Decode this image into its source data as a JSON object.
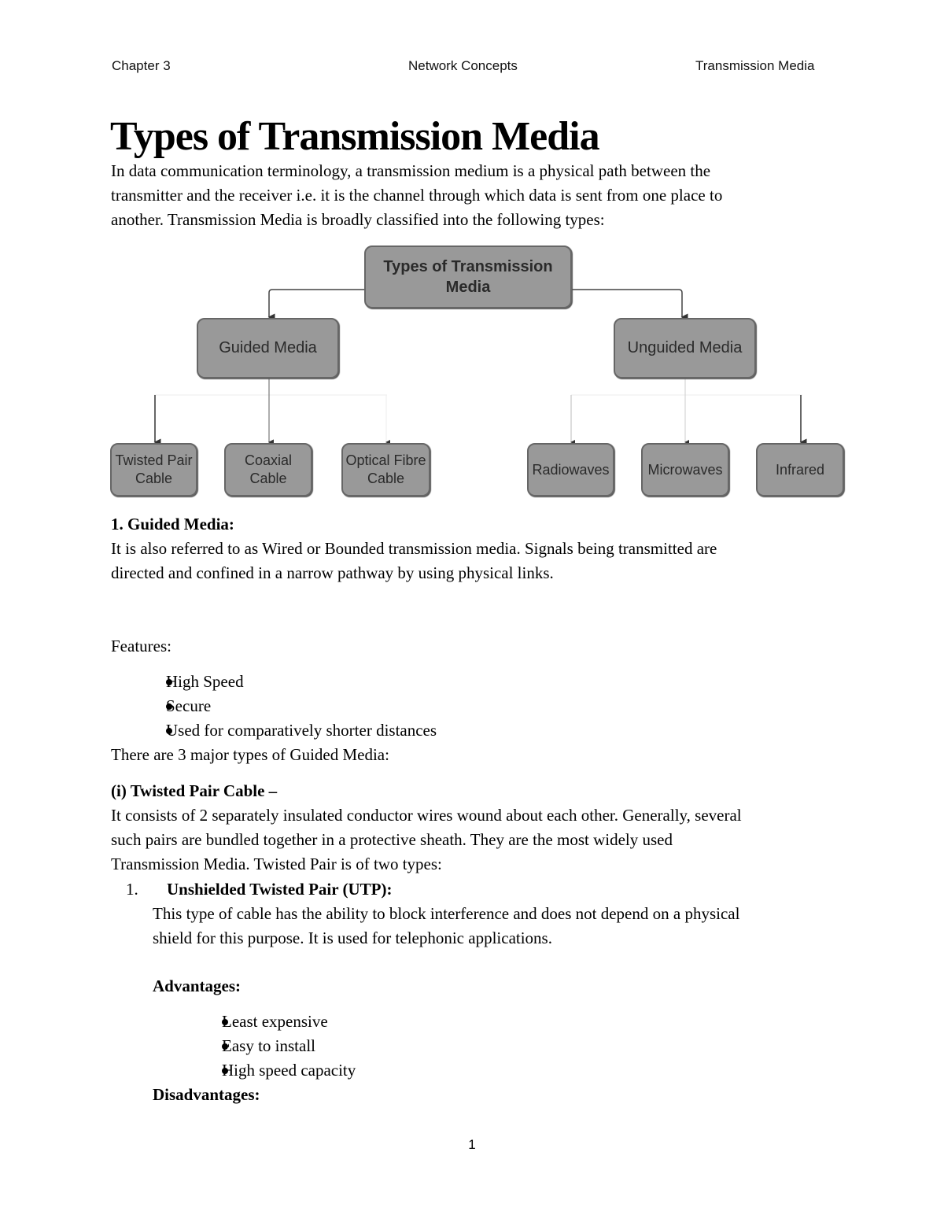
{
  "header": {
    "left": "Chapter 3",
    "center": "Network Concepts",
    "right": "Transmission Media"
  },
  "title": "Types of Transmission Media",
  "intro": [
    "In data communication terminology, a transmission medium is a physical path between the",
    "transmitter and the receiver i.e. it is the channel through which data is sent from one place to",
    "another. Transmission Media is broadly classified into the following types:"
  ],
  "diagram": {
    "root": "Types of Transmission Media",
    "guided": {
      "label": "Guided Media",
      "children": [
        "Twisted Pair Cable",
        "Coaxial Cable",
        "Optical Fibre Cable"
      ]
    },
    "unguided": {
      "label": "Unguided Media",
      "children": [
        "Radiowaves",
        "Microwaves",
        "Infrared"
      ]
    }
  },
  "guided_section": {
    "heading": "1. Guided Media:",
    "body": [
      "It is also referred to as Wired or Bounded transmission media. Signals being transmitted are",
      "directed and confined in a narrow pathway by using physical links."
    ],
    "features_label": "Features:",
    "features": [
      "High Speed",
      "Secure",
      "Used for comparatively shorter distances"
    ],
    "types_intro": "There are 3 major types of Guided Media:"
  },
  "twisted_pair": {
    "heading": "(i) Twisted Pair Cable –",
    "body": [
      "It consists of 2 separately insulated conductor wires wound about each other. Generally, several",
      "such pairs are bundled together in a protective sheath. They are the most widely used",
      "Transmission Media. Twisted Pair is of two types:"
    ],
    "utp": {
      "number": "1.",
      "heading": "Unshielded Twisted Pair (UTP):",
      "body": [
        "This type of cable has the ability to block interference and does not depend on a physical",
        "shield for this purpose. It is used for telephonic applications."
      ],
      "advantages_label": "Advantages:",
      "advantages": [
        "Least expensive",
        "Easy to install",
        "High speed capacity"
      ],
      "disadvantages_label": "Disadvantages:"
    }
  },
  "page_number": "1"
}
